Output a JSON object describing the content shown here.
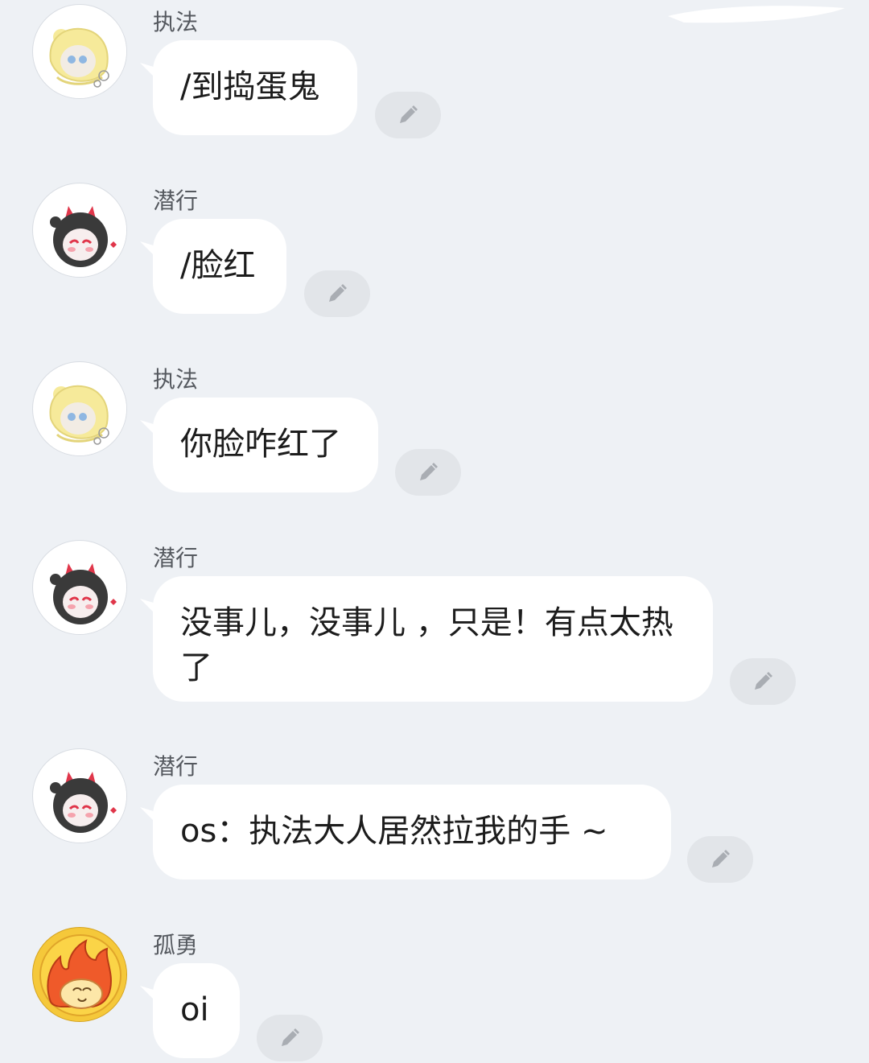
{
  "messages": [
    {
      "sender": "执法",
      "text": "/到捣蛋鬼",
      "avatar_icon": "yellow-hood-chibi-avatar"
    },
    {
      "sender": "潜行",
      "text": "/脸红",
      "avatar_icon": "devil-horns-chibi-avatar"
    },
    {
      "sender": "执法",
      "text": "你脸咋红了",
      "avatar_icon": "yellow-hood-chibi-avatar"
    },
    {
      "sender": "潜行",
      "text": "没事儿，没事儿 ，只是！有点太热了",
      "avatar_icon": "devil-horns-chibi-avatar"
    },
    {
      "sender": "潜行",
      "text": "os：执法大人居然拉我的手 ~",
      "avatar_icon": "devil-horns-chibi-avatar"
    },
    {
      "sender": "孤勇",
      "text": "oi",
      "avatar_icon": "flame-chick-avatar"
    }
  ],
  "edit_icon": "pencil-icon",
  "colors": {
    "background": "#eef1f5",
    "bubble": "#ffffff",
    "edit_button": "#e2e5e9",
    "sender_text": "#55595f",
    "message_text": "#1c1c1c"
  }
}
